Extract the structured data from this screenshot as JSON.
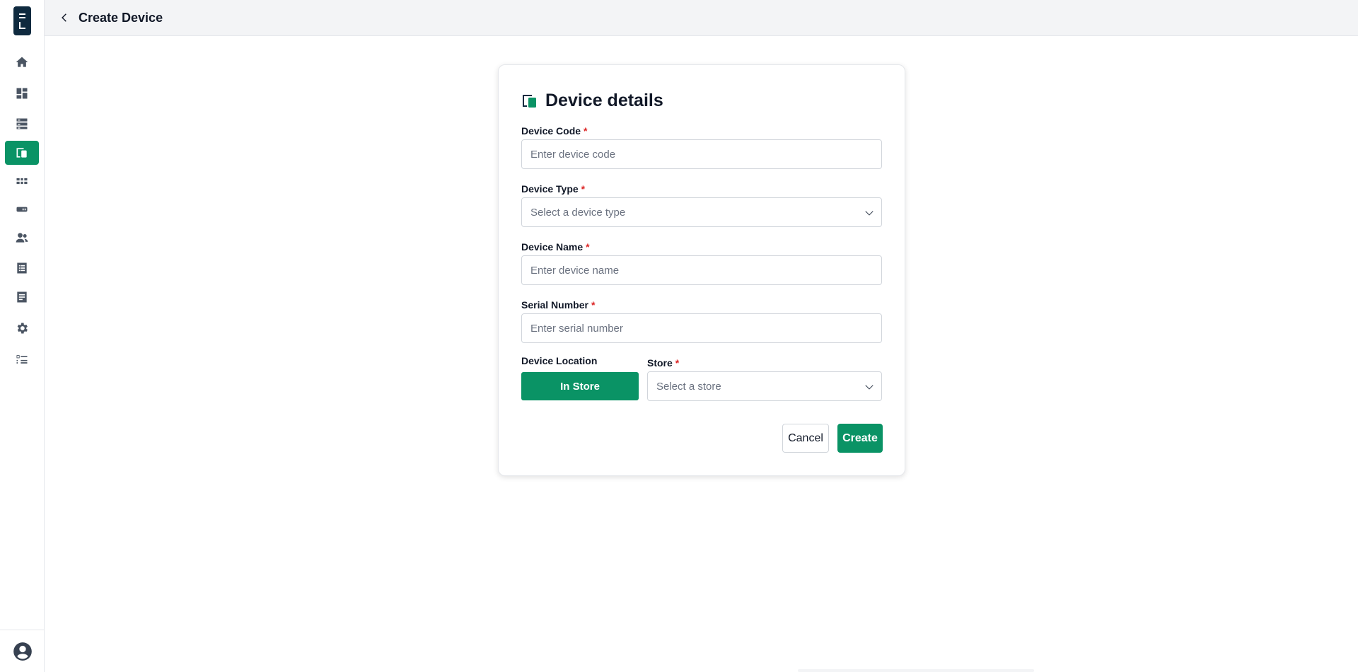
{
  "app": {
    "logo_alt": "logo"
  },
  "header": {
    "title": "Create Device"
  },
  "sidebar": {
    "items": [
      {
        "name": "home",
        "icon": "home-icon",
        "active": false
      },
      {
        "name": "dashboard",
        "icon": "dashboard-icon",
        "active": false
      },
      {
        "name": "servers",
        "icon": "server-icon",
        "active": false
      },
      {
        "name": "devices",
        "icon": "devices-icon",
        "active": true
      },
      {
        "name": "apps",
        "icon": "apps-grid-icon",
        "active": false
      },
      {
        "name": "hardware",
        "icon": "hardware-icon",
        "active": false
      },
      {
        "name": "users",
        "icon": "users-icon",
        "active": false
      },
      {
        "name": "lists",
        "icon": "list-icon",
        "active": false
      },
      {
        "name": "reports",
        "icon": "report-icon",
        "active": false
      },
      {
        "name": "settings",
        "icon": "gear-icon",
        "active": false
      },
      {
        "name": "tasks",
        "icon": "task-list-icon",
        "active": false
      }
    ]
  },
  "card": {
    "title": "Device details",
    "device_code": {
      "label": "Device Code",
      "required": "*",
      "placeholder": "Enter device code",
      "value": ""
    },
    "device_type": {
      "label": "Device Type",
      "required": "*",
      "placeholder": "Select a device type"
    },
    "device_name": {
      "label": "Device Name",
      "required": "*",
      "placeholder": "Enter device name",
      "value": ""
    },
    "serial_number": {
      "label": "Serial Number",
      "required": "*",
      "placeholder": "Enter serial number",
      "value": ""
    },
    "device_location": {
      "label": "Device Location",
      "button": "In Store"
    },
    "store": {
      "label": "Store",
      "required": "*",
      "placeholder": "Select a store"
    },
    "actions": {
      "cancel": "Cancel",
      "create": "Create"
    }
  },
  "colors": {
    "accent": "#0a9365",
    "required": "#dc2626",
    "logo": "#0f2a3f"
  }
}
